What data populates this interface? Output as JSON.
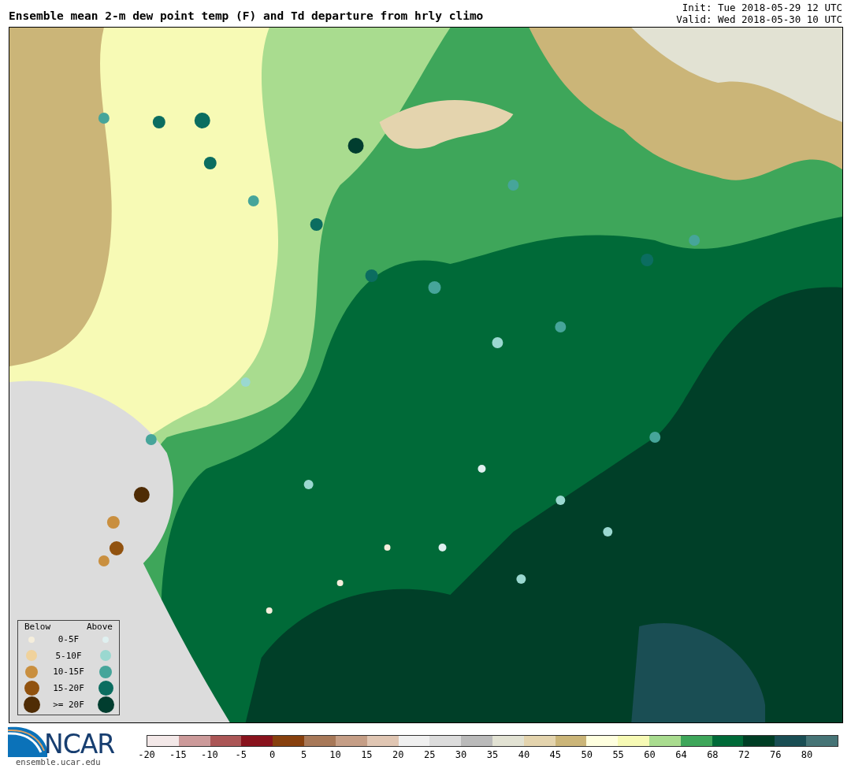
{
  "header": {
    "title": "Ensemble mean 2-m dew point temp (F) and Td departure from hrly climo",
    "init": "Init: Tue 2018-05-29 12 UTC",
    "valid": "Valid: Wed 2018-05-30 10 UTC"
  },
  "legend": {
    "below_heading": "Below",
    "above_heading": "Above",
    "rows": [
      {
        "label": "0-5F",
        "below": {
          "color": "#f5eedc"
        },
        "above": {
          "color": "#dff0f0"
        }
      },
      {
        "label": "5-10F",
        "below": {
          "color": "#f0d29c"
        },
        "above": {
          "color": "#9ad8d0"
        }
      },
      {
        "label": "10-15F",
        "below": {
          "color": "#c98f3f"
        },
        "above": {
          "color": "#46a59a"
        }
      },
      {
        "label": "15-20F",
        "below": {
          "color": "#91520f"
        },
        "above": {
          "color": "#0b6d60"
        }
      },
      {
        "label": ">= 20F",
        "below": {
          "color": "#4f2c05"
        },
        "above": {
          "color": "#013d2f"
        }
      }
    ]
  },
  "logo": {
    "text": "NCAR",
    "url": "ensemble.ucar.edu"
  },
  "colorbar": {
    "bins": [
      {
        "color": "#f3e8e8"
      },
      {
        "color": "#cc9a9a"
      },
      {
        "color": "#ab5656"
      },
      {
        "color": "#89131d"
      },
      {
        "color": "#87400e"
      },
      {
        "color": "#a77858"
      },
      {
        "color": "#c59e86"
      },
      {
        "color": "#e0c6b3"
      },
      {
        "color": "#f0f0f0"
      },
      {
        "color": "#dcdcdc"
      },
      {
        "color": "#bababa"
      },
      {
        "color": "#e2e2d3"
      },
      {
        "color": "#e4d4ae"
      },
      {
        "color": "#cbb578"
      },
      {
        "color": "#ffffdf"
      },
      {
        "color": "#f7fab5"
      },
      {
        "color": "#a9dc8f"
      },
      {
        "color": "#3ea65a"
      },
      {
        "color": "#006a38"
      },
      {
        "color": "#003e25"
      },
      {
        "color": "#1a4e54"
      },
      {
        "color": "#467476"
      }
    ],
    "ticks": [
      "-20",
      "-15",
      "-10",
      "-5",
      "0",
      "5",
      "10",
      "15",
      "20",
      "25",
      "30",
      "35",
      "40",
      "45",
      "50",
      "55",
      "60",
      "64",
      "68",
      "72",
      "76",
      "80"
    ]
  }
}
